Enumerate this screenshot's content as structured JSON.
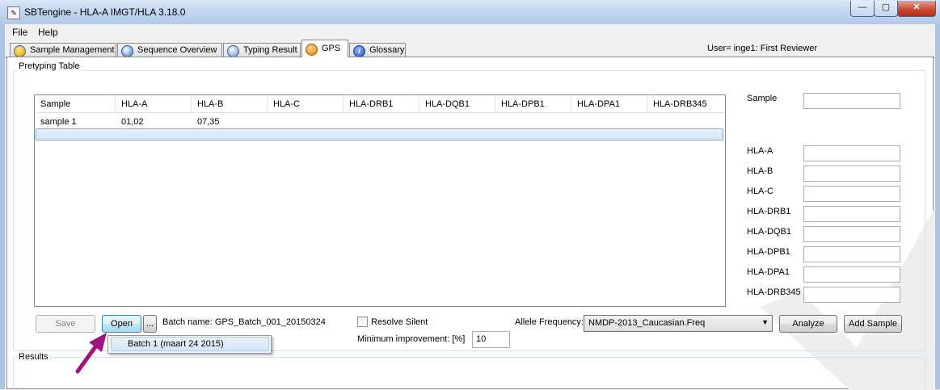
{
  "window": {
    "title": "SBTengine - HLA-A IMGT/HLA 3.18.0",
    "minimize": "—",
    "maximize": "▢",
    "close": "✕"
  },
  "menu": [
    "File",
    "Help"
  ],
  "tabs": [
    {
      "label": "Sample Management",
      "icon": "sample-icon"
    },
    {
      "label": "Sequence Overview",
      "icon": "sequence-icon"
    },
    {
      "label": "Typing Result",
      "icon": "typing-icon"
    },
    {
      "label": "GPS",
      "icon": "gps-icon",
      "active": true
    },
    {
      "label": "Glossary",
      "icon": "info-icon"
    }
  ],
  "user": "User= inge1: First Reviewer",
  "pretyping": {
    "title": "Pretyping Table",
    "columns": [
      "Sample",
      "HLA-A",
      "HLA-B",
      "HLA-C",
      "HLA-DRB1",
      "HLA-DQB1",
      "HLA-DPB1",
      "HLA-DPA1",
      "HLA-DRB345"
    ],
    "rows": [
      [
        "sample 1",
        "01,02",
        "07,35",
        "",
        "",
        "",
        "",
        "",
        ""
      ]
    ]
  },
  "side": {
    "sample_label": "Sample",
    "fields": [
      "HLA-A",
      "HLA-B",
      "HLA-C",
      "HLA-DRB1",
      "HLA-DQB1",
      "HLA-DPB1",
      "HLA-DPA1",
      "HLA-DRB345"
    ]
  },
  "controls": {
    "save": "Save",
    "open": "Open",
    "browse": "...",
    "batch_name": "Batch name: GPS_Batch_001_20150324",
    "resolve_silent": "Resolve Silent",
    "min_improvement": "Minimum improvement: [%]",
    "min_value": "10",
    "allele_freq_label": "Allele Frequency:",
    "allele_freq_value": "NMDP-2013_Caucasian.Freq",
    "analyze": "Analyze",
    "add_sample": "Add Sample"
  },
  "dropdown": {
    "item": "Batch 1 (maart 24 2015)"
  },
  "results": {
    "title": "Results"
  },
  "colors": {
    "accent": "#3c7fb1",
    "arrow": "#a0147c"
  }
}
